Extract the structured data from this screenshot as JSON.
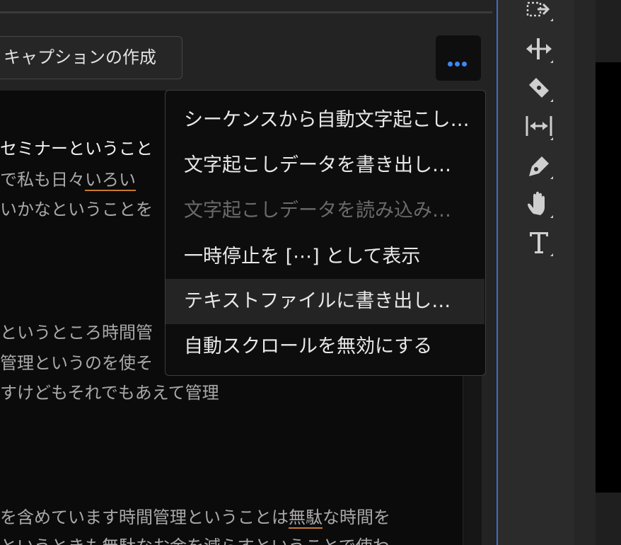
{
  "toolbar": {
    "caption_button_label": "キャプションの作成",
    "more_icon": "ellipsis-icon",
    "accent_color": "#3f87f5"
  },
  "transcript": {
    "lines": [
      "セミナーということ",
      "で私も日々いろい",
      "いかなということを",
      "というところ時間管",
      "管理というのを使そ",
      "すけどもそれでもあえて管理",
      "を含めています時間管理ということは無駄な時間を",
      "というときも無駄なお金を減らすということで使わ"
    ],
    "underlined_words": [
      "いろい",
      "無駄"
    ]
  },
  "menu": {
    "items": [
      {
        "label": "シーケンスから自動文字起こし…",
        "disabled": false
      },
      {
        "label": "文字起こしデータを書き出し…",
        "disabled": false
      },
      {
        "label": "文字起こしデータを読み込み…",
        "disabled": true
      },
      {
        "label": "一時停止を [⋯] として表示",
        "disabled": false
      },
      {
        "label": "テキストファイルに書き出し…",
        "disabled": false,
        "highlighted": true
      },
      {
        "label": "自動スクロールを無効にする",
        "disabled": false
      }
    ]
  },
  "tools": [
    "track-select-forward-icon",
    "ripple-edit-icon",
    "razor-icon",
    "slip-icon",
    "pen-icon",
    "hand-icon",
    "type-icon"
  ]
}
